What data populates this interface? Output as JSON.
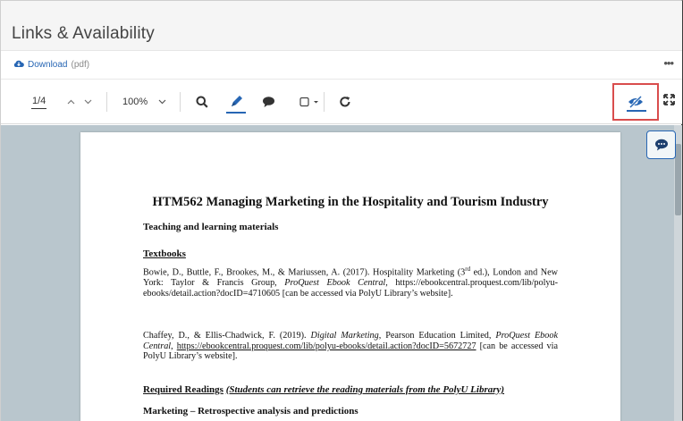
{
  "header": {
    "title": "Links & Availability"
  },
  "download": {
    "label": "Download",
    "format": "(pdf)"
  },
  "menu": {
    "more_label": "•••"
  },
  "toolbar": {
    "page_indicator": "1/4",
    "prev_page": "^",
    "next_page": "v",
    "zoom_level": "100%",
    "zoom_dropdown": "v",
    "icons": [
      "search-icon",
      "pen-icon",
      "comment-icon",
      "shape-icon",
      "refresh-icon",
      "eye-slash-icon",
      "expand-icon"
    ]
  },
  "colors": {
    "accent": "#2766b4",
    "highlight_box": "#d94d4d",
    "viewer_bg": "#b9c6cd"
  },
  "document": {
    "title": "HTM562 Managing Marketing in the Hospitality and Tourism Industry",
    "subtitle": "Teaching and learning materials",
    "section_textbooks": "Textbooks",
    "ref1": {
      "text_a": "Bowie, D., Buttle, F., Brookes, M., & Mariussen, A. (2017). Hospitality Marketing (3",
      "sup": "rd",
      "text_b": " ed.), London and New York: Taylor & Francis Group, ",
      "italic": "ProQuest Ebook Central",
      "text_c": ", https://ebookcentral.proquest.com/lib/polyu-ebooks/detail.action?docID=4710605 [can be accessed via PolyU Library’s website]."
    },
    "ref2": {
      "text_a": "Chaffey, D., & Ellis-Chadwick, F. (2019). ",
      "italic_a": "Digital Marketing",
      "text_b": ", Pearson Education Limited, ",
      "italic_b": "ProQuest Ebook Central",
      "text_c": ", ",
      "link": "https://ebookcentral.proquest.com/lib/polyu-ebooks/detail.action?docID=5672727",
      "text_d": " [can be accessed via PolyU Library’s website]."
    },
    "section_required": "Required Readings",
    "section_required_note": "(Students can retrieve the reading materials from the PolyU Library)",
    "section_marketing": "Marketing – Retrospective analysis and predictions"
  }
}
